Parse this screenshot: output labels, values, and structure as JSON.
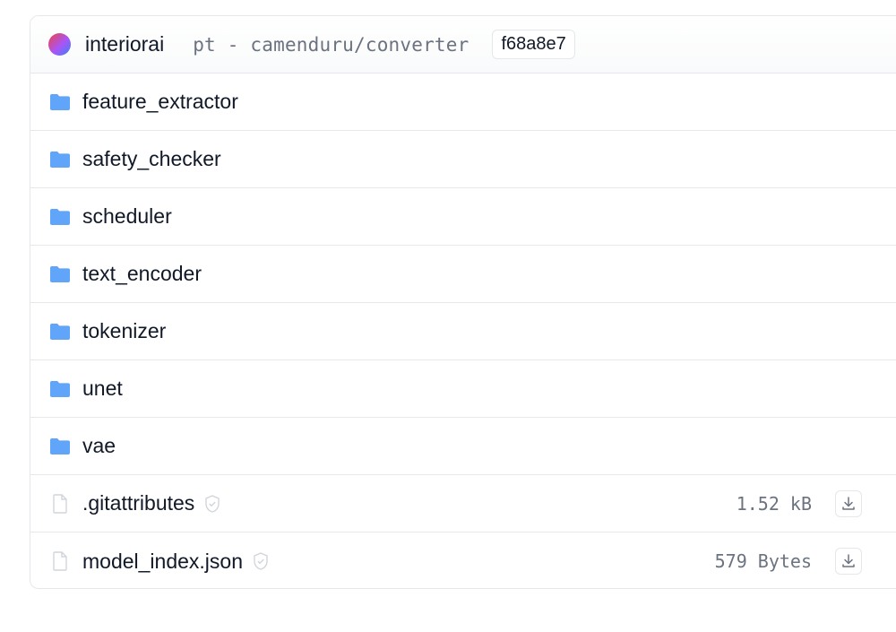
{
  "header": {
    "author": "interiorai",
    "commit_message": "pt - camenduru/converter",
    "commit_hash": "f68a8e7"
  },
  "folders": [
    {
      "name": "feature_extractor",
      "icon": "folder-icon"
    },
    {
      "name": "safety_checker",
      "icon": "folder-icon"
    },
    {
      "name": "scheduler",
      "icon": "folder-icon"
    },
    {
      "name": "text_encoder",
      "icon": "folder-icon"
    },
    {
      "name": "tokenizer",
      "icon": "folder-icon"
    },
    {
      "name": "unet",
      "icon": "folder-icon"
    },
    {
      "name": "vae",
      "icon": "folder-icon"
    }
  ],
  "files": [
    {
      "name": ".gitattributes",
      "size": "1.52 kB",
      "icon": "file-icon",
      "badge_icon": "shield-icon",
      "action_icon": "download-icon"
    },
    {
      "name": "model_index.json",
      "size": "579 Bytes",
      "icon": "file-icon",
      "badge_icon": "shield-icon",
      "action_icon": "download-icon"
    }
  ],
  "colors": {
    "folder": "#60a5fa",
    "border": "#e5e7eb",
    "muted_text": "#6b7280"
  }
}
